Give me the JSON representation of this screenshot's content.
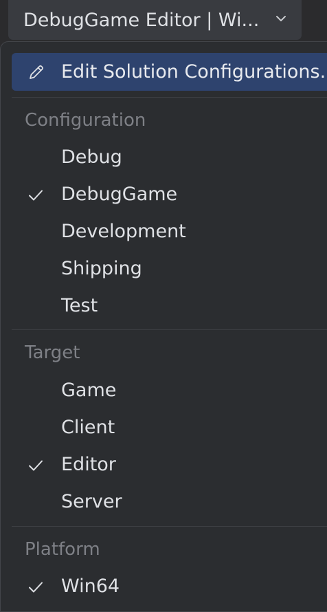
{
  "toolbar": {
    "config_selector_label": "DebugGame Editor | Wi..."
  },
  "popup": {
    "edit_label": "Edit Solution Configurations...",
    "sections": [
      {
        "header": "Configuration",
        "items": [
          {
            "label": "Debug",
            "checked": false
          },
          {
            "label": "DebugGame",
            "checked": true
          },
          {
            "label": "Development",
            "checked": false
          },
          {
            "label": "Shipping",
            "checked": false
          },
          {
            "label": "Test",
            "checked": false
          }
        ]
      },
      {
        "header": "Target",
        "items": [
          {
            "label": "Game",
            "checked": false
          },
          {
            "label": "Client",
            "checked": false
          },
          {
            "label": "Editor",
            "checked": true
          },
          {
            "label": "Server",
            "checked": false
          }
        ]
      },
      {
        "header": "Platform",
        "items": [
          {
            "label": "Win64",
            "checked": true
          }
        ]
      }
    ]
  },
  "colors": {
    "accent_selected": "#2e436e",
    "popup_bg": "#2b2d30",
    "header_text": "#7e8086",
    "item_text": "#dfe1e5"
  },
  "icons": {
    "edit": "pencil-icon",
    "checked": "checkmark-icon",
    "dropdown": "chevron-down-icon"
  }
}
